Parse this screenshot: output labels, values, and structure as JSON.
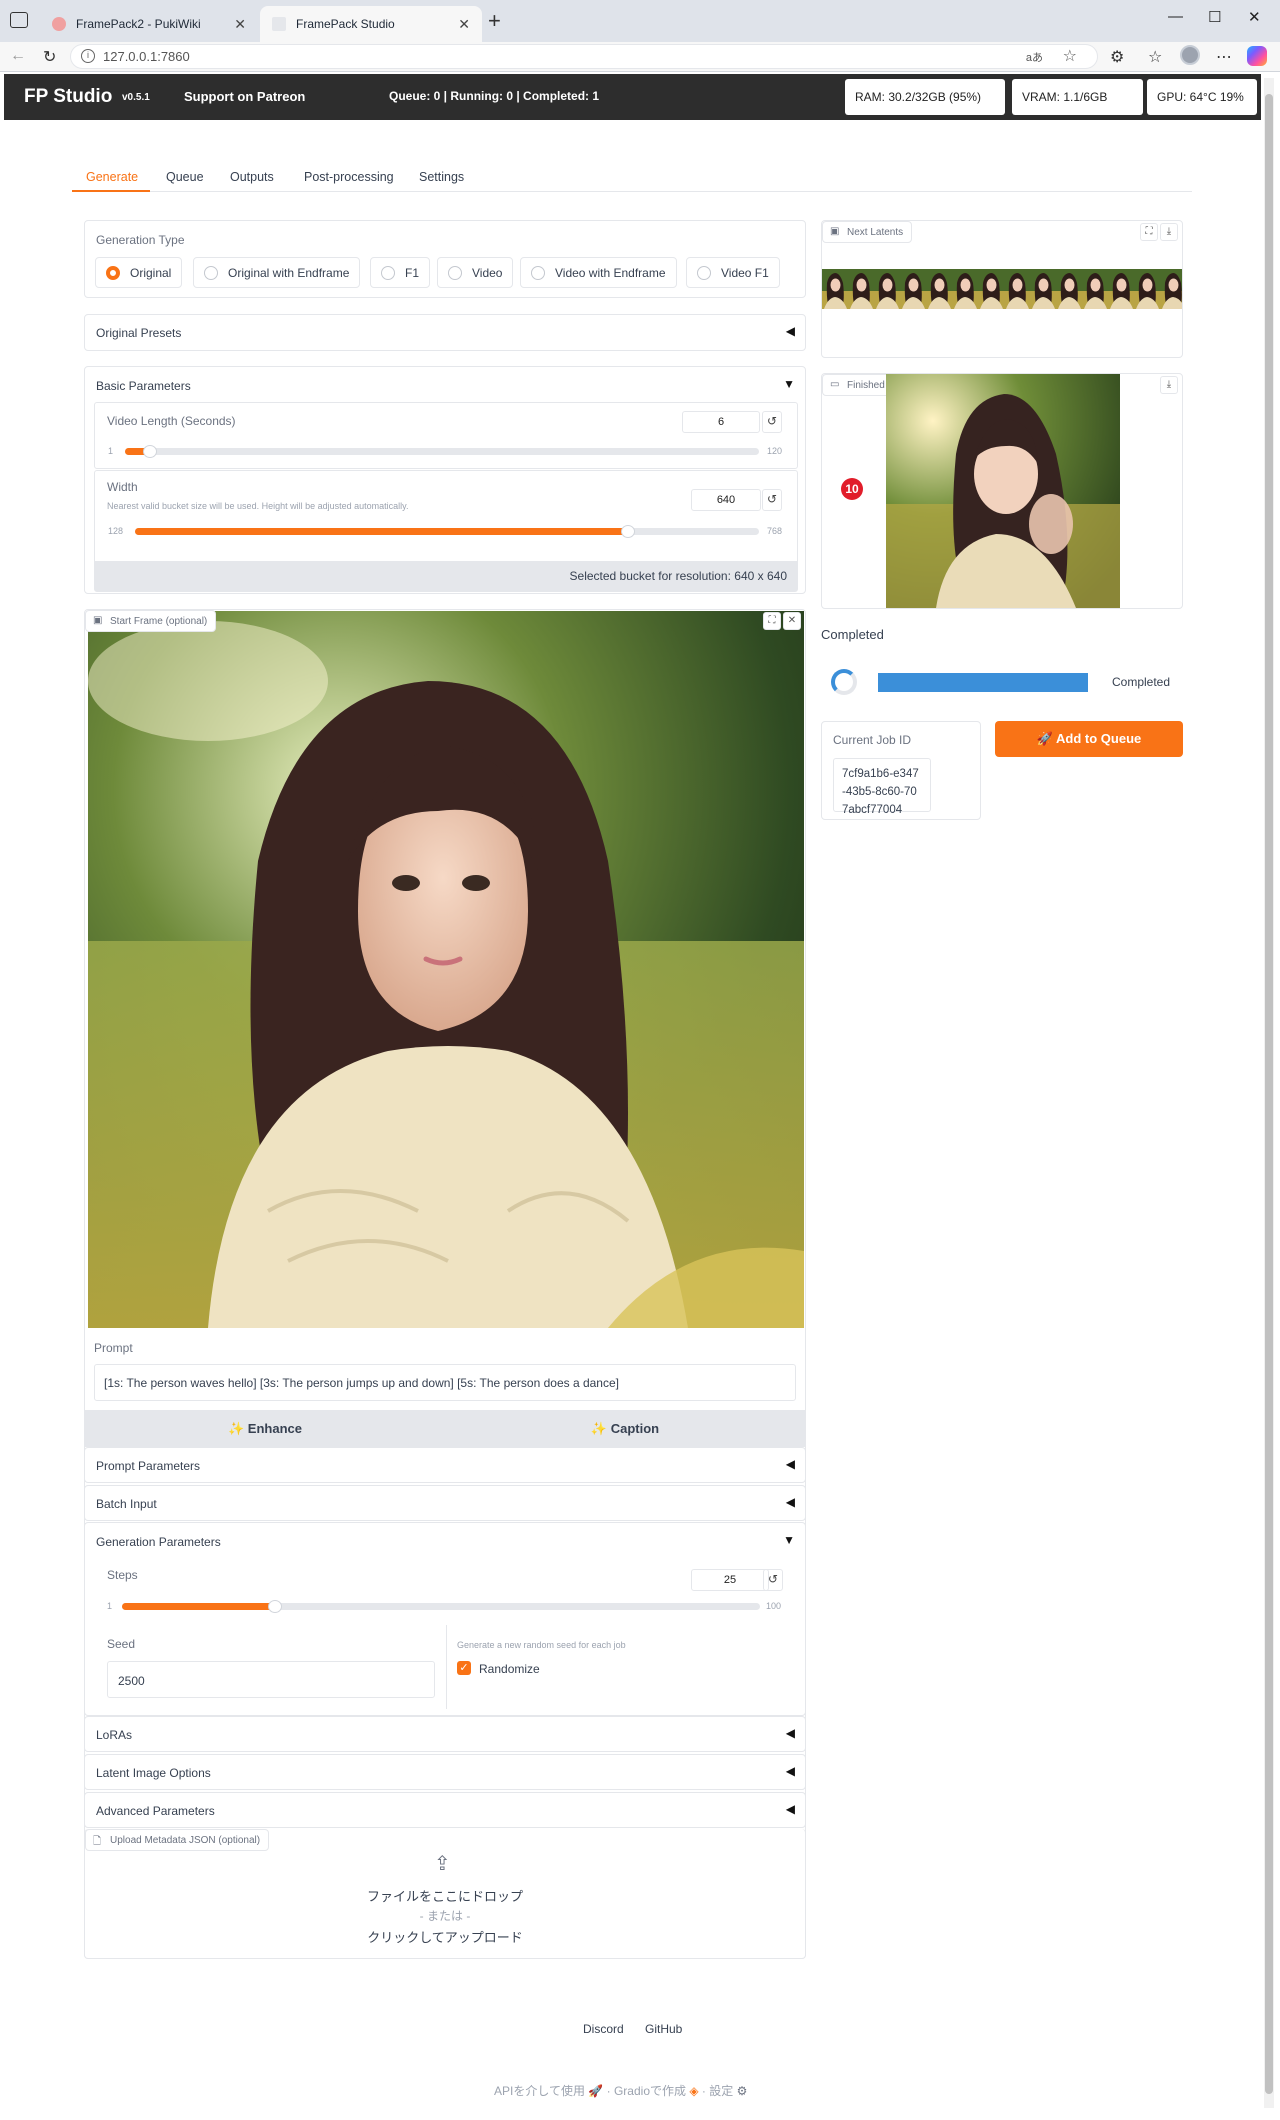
{
  "browser": {
    "tabs": [
      {
        "title": "FramePack2 - PukiWiki"
      },
      {
        "title": "FramePack Studio"
      }
    ],
    "url": "127.0.0.1:7860",
    "read_aloud": "aあ"
  },
  "header": {
    "brand": "FP Studio",
    "version": "v0.5.1",
    "patreon": "Support on Patreon",
    "queue_status": "Queue: 0 | Running: 0 | Completed: 1",
    "ram": "RAM: 30.2/32GB (95%)",
    "vram": "VRAM: 1.1/6GB",
    "gpu": "GPU: 64°C 19%"
  },
  "tabs": [
    "Generate",
    "Queue",
    "Outputs",
    "Post-processing",
    "Settings"
  ],
  "generation_type": {
    "label": "Generation Type",
    "options": [
      "Original",
      "Original with Endframe",
      "F1",
      "Video",
      "Video with Endframe",
      "Video F1"
    ],
    "selected": "Original"
  },
  "original_presets": {
    "label": "Original Presets"
  },
  "basic_parameters": {
    "label": "Basic Parameters",
    "video_length": {
      "label": "Video Length (Seconds)",
      "value": "6",
      "min": "1",
      "max": "120",
      "fraction": 0.04
    },
    "width": {
      "label": "Width",
      "note": "Nearest valid bucket size will be used. Height will be adjusted automatically.",
      "value": "640",
      "min": "128",
      "max": "768",
      "fraction": 0.79
    },
    "bucket": "Selected bucket for resolution: 640 x 640"
  },
  "start_frame": {
    "label": "Start Frame (optional)"
  },
  "prompt": {
    "label": "Prompt",
    "value": "[1s: The person waves hello] [3s: The person jumps up and down] [5s: The person does a dance]"
  },
  "buttons": {
    "enhance": "✨ Enhance",
    "caption": "✨ Caption",
    "add_to_queue": "🚀 Add to Queue"
  },
  "accordions": {
    "prompt_parameters": "Prompt Parameters",
    "batch_input": "Batch Input",
    "generation_parameters": "Generation Parameters",
    "loras": "LoRAs",
    "latent_image_options": "Latent Image Options",
    "advanced_parameters": "Advanced Parameters"
  },
  "generation_parameters": {
    "steps": {
      "label": "Steps",
      "value": "25",
      "min": "1",
      "max": "100",
      "fraction": 0.24
    },
    "seed": {
      "label": "Seed",
      "value": "2500"
    },
    "randomize_note": "Generate a new random seed for each job",
    "randomize": {
      "label": "Randomize",
      "checked": true
    }
  },
  "upload": {
    "label": "Upload Metadata JSON (optional)",
    "drop": "ファイルをここにドロップ",
    "or": "- または -",
    "click": "クリックしてアップロード"
  },
  "right": {
    "next_latents": "Next Latents",
    "finished_frames": "Finished Frames",
    "frame_badge": "10",
    "completed_label": "Completed",
    "progress_status": "Completed",
    "progress_fraction": 1.0,
    "job_id_label": "Current Job ID",
    "job_id": "7cf9a1b6-e347-43b5-8c60-707abcf77004"
  },
  "footer": {
    "discord": "Discord",
    "github": "GitHub",
    "api": "APIを介して使用",
    "gradio": "Gradioで作成",
    "settings": "設定"
  },
  "colors": {
    "accent": "#f97316",
    "progress": "#3b8fd9",
    "header_bg": "#2d2d2d"
  }
}
